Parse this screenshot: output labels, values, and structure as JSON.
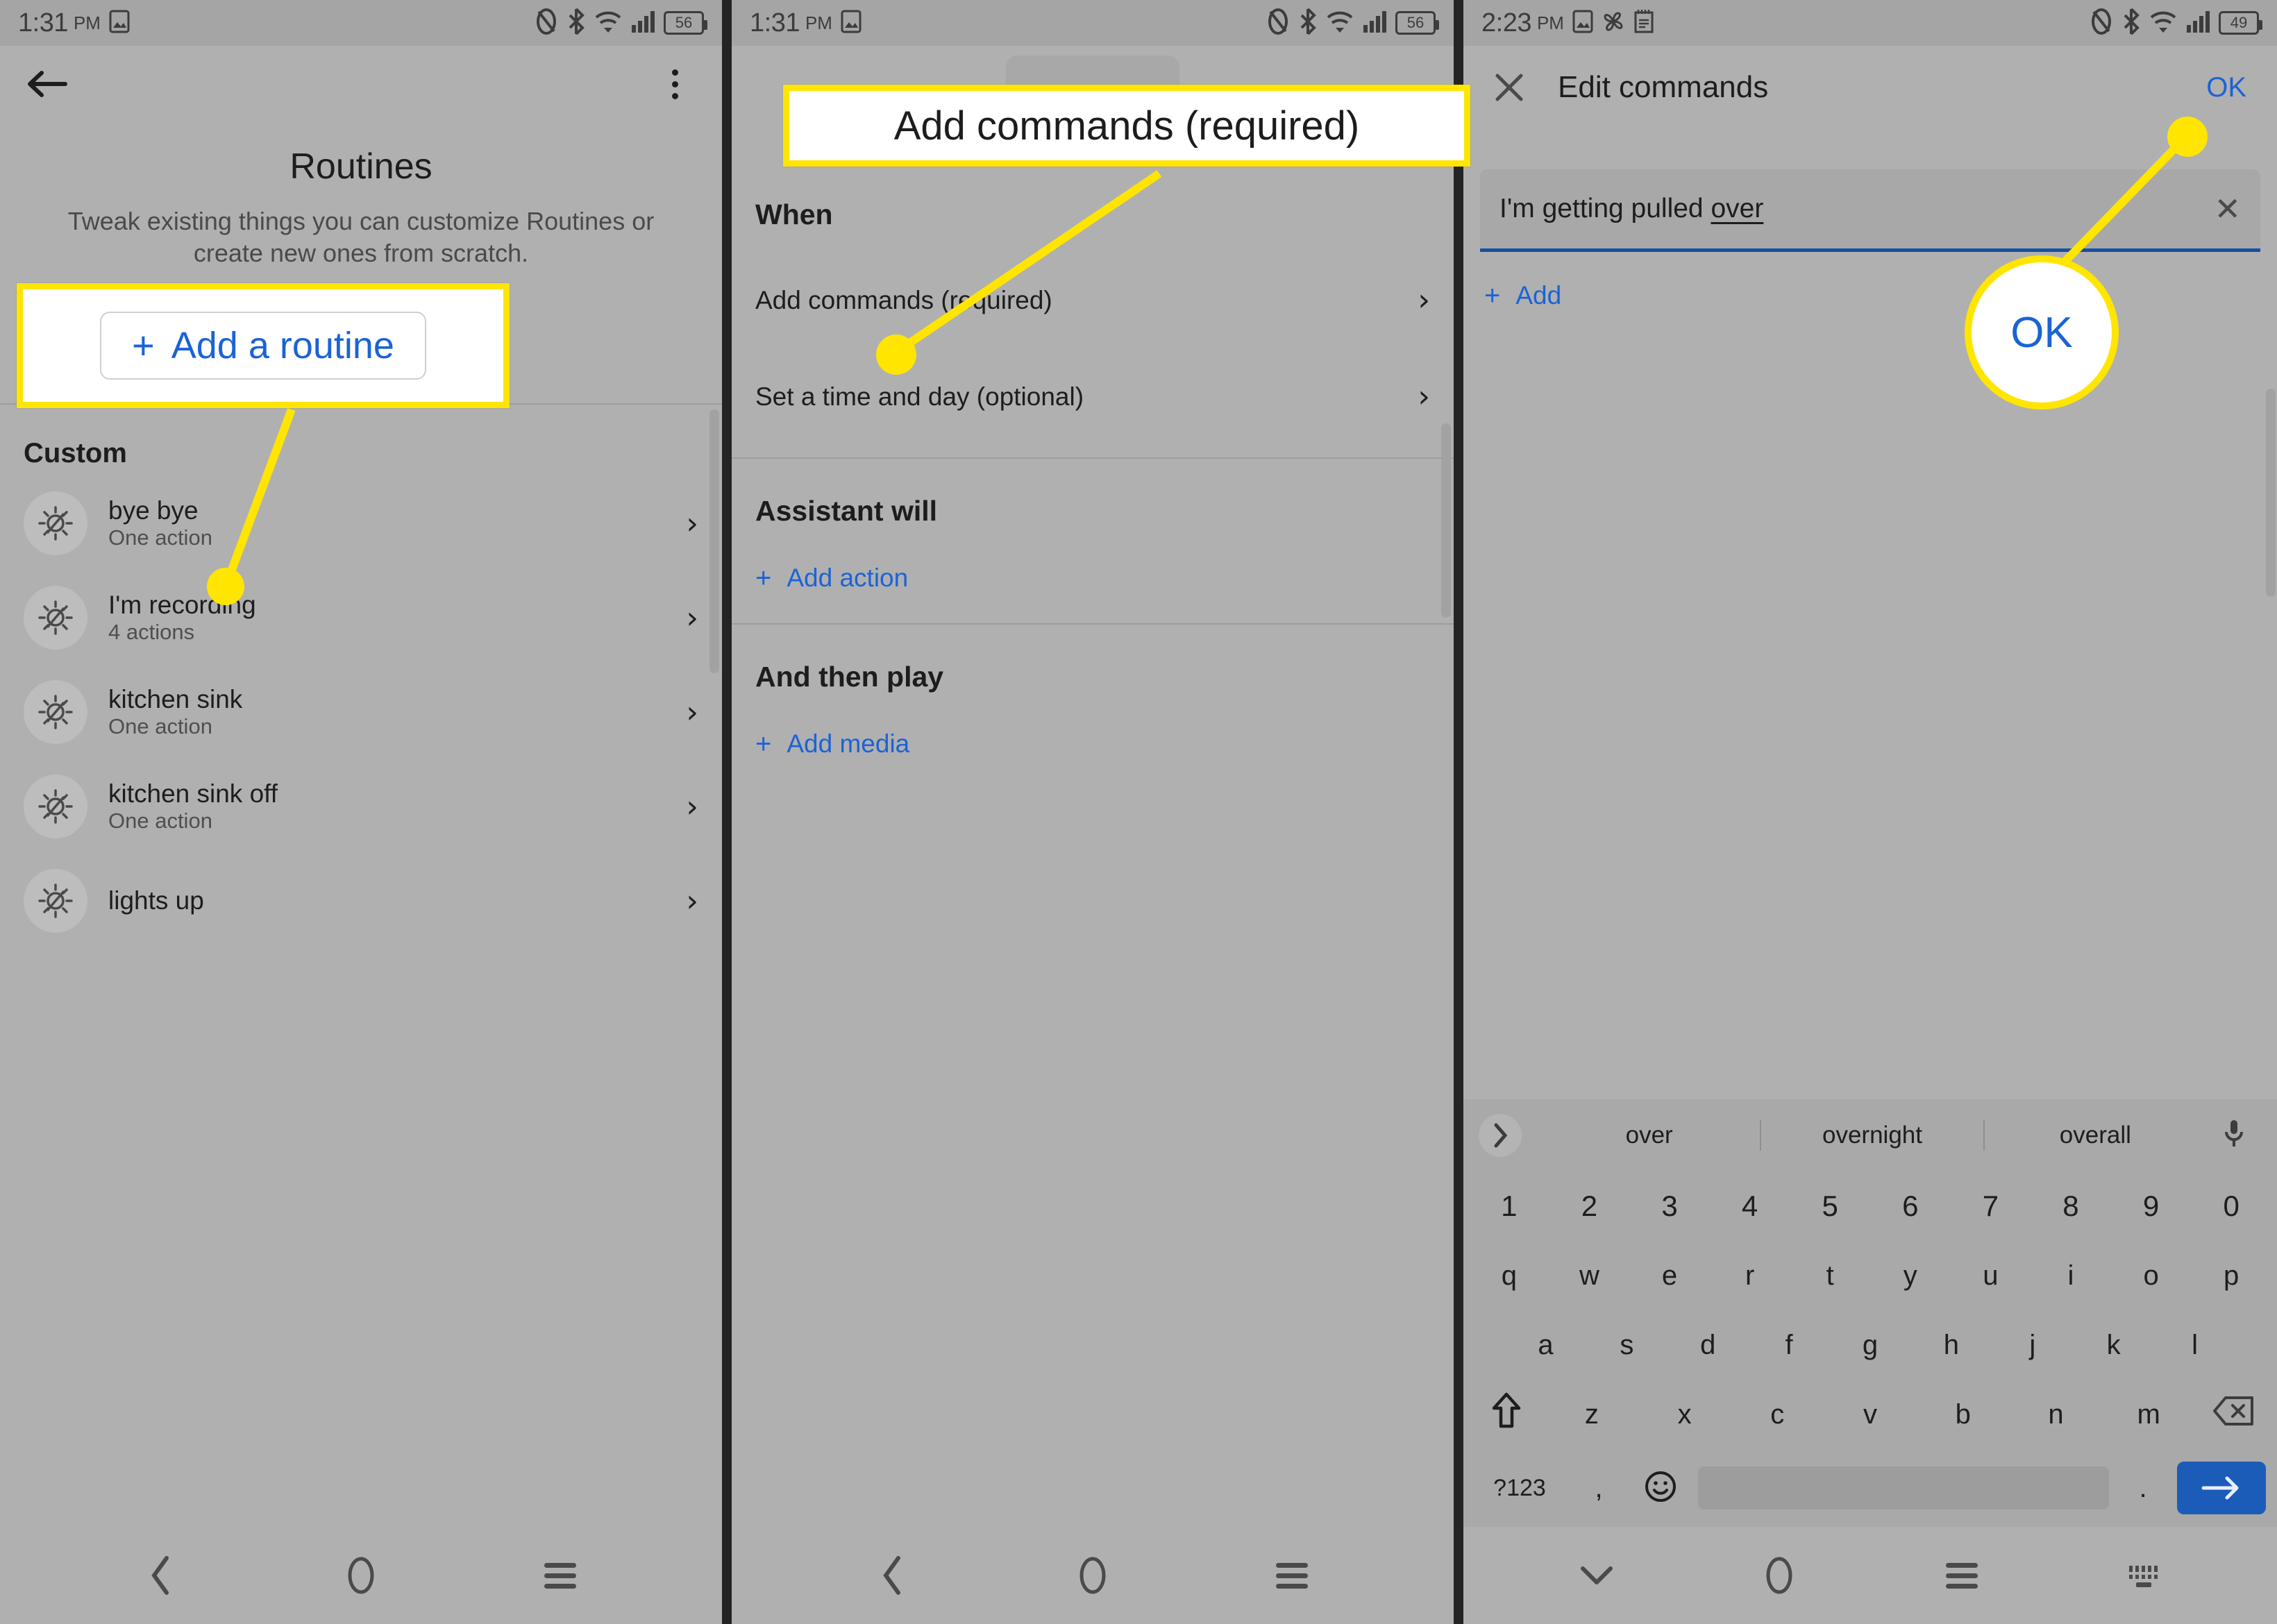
{
  "panels": [
    {
      "status": {
        "time": "1:31",
        "ampm": "PM",
        "battery": "56",
        "icons": [
          "image-icon",
          "nfc-icon",
          "bluetooth-icon",
          "wifi-icon",
          "signal-icon",
          "battery-icon"
        ]
      },
      "appbar": {
        "back_icon": "back-arrow-icon",
        "menu_icon": "overflow-menu-icon"
      },
      "title": "Routines",
      "description": "Tweak existing things you can customize Routines or create new ones from scratch.",
      "description_lines": [
        "e things",
        "mize",
        "Routines or create new ones from",
        "scratch."
      ],
      "add_button": {
        "plus": "+",
        "label": "Add a routine"
      },
      "section_header": "Custom",
      "rows": [
        {
          "title": "bye bye",
          "subtitle": "One action",
          "icon": "brightness-off-icon"
        },
        {
          "title": "I'm recording",
          "subtitle": "4 actions",
          "icon": "brightness-off-icon"
        },
        {
          "title": "kitchen sink",
          "subtitle": "One action",
          "icon": "brightness-off-icon"
        },
        {
          "title": "kitchen sink off",
          "subtitle": "One action",
          "icon": "brightness-off-icon"
        },
        {
          "title": "lights up",
          "subtitle": "",
          "icon": "brightness-off-icon"
        }
      ],
      "nav": [
        "back-icon",
        "home-icon",
        "recents-icon"
      ]
    },
    {
      "status": {
        "time": "1:31",
        "ampm": "PM",
        "battery": "56"
      },
      "groups": [
        {
          "header": "When",
          "rows": [
            "Add commands (required)",
            "Set a time and day (optional)"
          ]
        },
        {
          "header": "Assistant will",
          "link": {
            "plus": "+",
            "label": "Add action"
          }
        },
        {
          "header": "And then play",
          "link": {
            "plus": "+",
            "label": "Add media"
          }
        }
      ],
      "nav": [
        "back-icon",
        "home-icon",
        "recents-icon"
      ]
    },
    {
      "status": {
        "time": "2:23",
        "ampm": "PM",
        "battery": "49",
        "icons": [
          "image-icon",
          "fan-icon",
          "notepad-icon",
          "nfc-icon",
          "bluetooth-icon",
          "wifi-icon",
          "signal-icon"
        ]
      },
      "appbar": {
        "close_icon": "close-icon",
        "title": "Edit commands",
        "ok_label": "OK"
      },
      "command_field": {
        "value_prefix": "I'm getting pulled ",
        "value_misspelled": "over",
        "clear_icon": "clear-x-icon"
      },
      "add_link": {
        "plus": "+",
        "label": "Add"
      },
      "keyboard": {
        "suggestions": [
          "over",
          "overnight",
          "overall"
        ],
        "expand_icon": "chevron-right-icon",
        "mic_icon": "microphone-icon",
        "number_row": [
          "1",
          "2",
          "3",
          "4",
          "5",
          "6",
          "7",
          "8",
          "9",
          "0"
        ],
        "row1": [
          "q",
          "w",
          "e",
          "r",
          "t",
          "y",
          "u",
          "i",
          "o",
          "p"
        ],
        "row2": [
          "a",
          "s",
          "d",
          "f",
          "g",
          "h",
          "j",
          "k",
          "l"
        ],
        "row3": [
          "z",
          "x",
          "c",
          "v",
          "b",
          "n",
          "m"
        ],
        "shift_icon": "shift-icon",
        "backspace_icon": "backspace-icon",
        "symbols_key": "?123",
        "comma_key": ",",
        "emoji_icon": "emoji-icon",
        "period_key": ".",
        "enter_icon": "enter-arrow-icon"
      },
      "nav": [
        "hide-keyboard-icon",
        "home-icon",
        "recents-icon",
        "keyboard-switch-icon"
      ]
    }
  ],
  "callouts": [
    {
      "id": "add-a-routine-callout",
      "plus": "+",
      "label": "Add a routine"
    },
    {
      "id": "add-commands-callout",
      "label": "Add commands (required)"
    },
    {
      "id": "ok-callout",
      "label": "OK"
    }
  ],
  "colors": {
    "accent_blue": "#1b63d6",
    "highlight_yellow": "#ffe500",
    "panel_bg": "#b0b0b0",
    "statusbar_bg": "#a5a5a5",
    "enter_blue": "#1b5cb8"
  }
}
